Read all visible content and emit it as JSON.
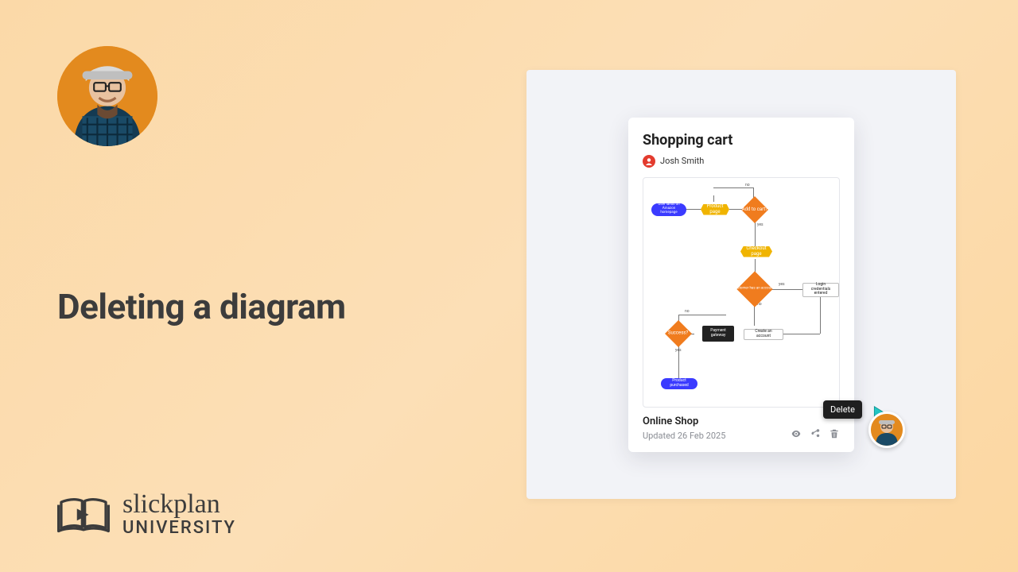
{
  "colors": {
    "bg_start": "#fbd9a8",
    "bg_end": "#fcd7a1",
    "accent_orange": "#e38a1e",
    "text_dark": "#3c3c3c",
    "panel_bg": "#f2f3f7",
    "node_blue": "#3b3bff",
    "node_yellow": "#f0b400",
    "node_orange": "#f07c1e",
    "node_black": "#222222",
    "cursor_teal": "#21c7c5"
  },
  "headline": "Deleting a diagram",
  "branding": {
    "script": "slickplan",
    "caps": "UNIVERSITY",
    "icon_name": "open-book-play-icon"
  },
  "presenter": {
    "avatar_name": "presenter-avatar"
  },
  "app": {
    "card": {
      "title": "Shopping cart",
      "author": "Josh Smith",
      "project_name": "Online Shop",
      "updated_label": "Updated 26 Feb 2025",
      "tooltip_delete": "Delete",
      "icons": {
        "view": "eye-icon",
        "share": "share-icon",
        "delete": "trash-icon"
      },
      "flow": {
        "nodes": [
          {
            "id": "start",
            "label": "User lands on Amazon homepage",
            "shape": "pill",
            "color": "blue"
          },
          {
            "id": "product",
            "label": "Product page",
            "shape": "hex",
            "color": "yellow"
          },
          {
            "id": "addcart",
            "label": "Add to cart?",
            "shape": "diamond",
            "color": "orange"
          },
          {
            "id": "checkout",
            "label": "Checkout page",
            "shape": "hex",
            "color": "yellow"
          },
          {
            "id": "hasacct",
            "label": "Customer has an account?",
            "shape": "diamond",
            "color": "orange"
          },
          {
            "id": "success",
            "label": "Success?",
            "shape": "diamond",
            "color": "orange"
          },
          {
            "id": "gateway",
            "label": "Payment gateway",
            "shape": "rect",
            "color": "black"
          },
          {
            "id": "createacct",
            "label": "Create an account",
            "shape": "rect",
            "color": "white"
          },
          {
            "id": "login",
            "label": "Login credentials entered",
            "shape": "rect",
            "color": "white"
          },
          {
            "id": "purchased",
            "label": "Product purchased",
            "shape": "pill",
            "color": "blue"
          }
        ],
        "edge_labels": {
          "yes": "yes",
          "no": "no"
        }
      }
    },
    "cursor_name": "cursor-pointer-icon"
  }
}
